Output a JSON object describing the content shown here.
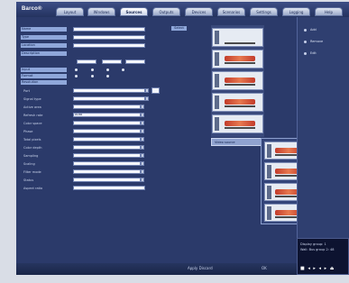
{
  "app": {
    "brand": "Barco®"
  },
  "tabs": [
    {
      "label": "Layout"
    },
    {
      "label": "Windows"
    },
    {
      "label": "Sources"
    },
    {
      "label": "Outputs"
    },
    {
      "label": "Devices"
    },
    {
      "label": "Scenarios"
    },
    {
      "label": "Settings"
    },
    {
      "label": "Logging"
    },
    {
      "label": "Help"
    }
  ],
  "top_labels": [
    "Name",
    "Type",
    "Location",
    "Description"
  ],
  "mid_labels": [
    "Input",
    "Format",
    "Resolution"
  ],
  "form_labels": [
    "Port",
    "Signal type",
    "Active area",
    "Refresh rate",
    "Color space",
    "Phase",
    "Total pixels",
    "Color depth",
    "Sampling",
    "Scaling",
    "Filter mode",
    "Status",
    "Aspect ratio"
  ],
  "form_values": [
    "",
    "",
    "",
    "Auto"
  ],
  "selection_chip": "Select",
  "context_menu": {
    "label": "Video source",
    "arrow": "▶"
  },
  "right_panel": {
    "buttons": [
      "Add",
      "Remove",
      "Edit"
    ]
  },
  "bottom": {
    "apply": "Apply  Discard",
    "ok": "OK"
  },
  "status": {
    "line1": "Display group: 1",
    "line2": "Wall: Bus group 2: 48",
    "icons": "■ ◂ ▸ ◂ ▸ ⏏"
  },
  "colors": {
    "background": "#2b3a6a",
    "accent": "#8fa7da",
    "tab": "#dfe5f1"
  }
}
